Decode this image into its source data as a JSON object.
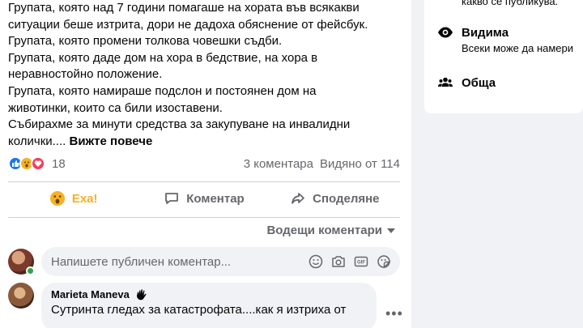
{
  "post": {
    "lines": [
      "Групата, която над 7 години помагаше на хората във всякакви",
      "ситуации беше изтрита, дори не дадоха обяснение от фейсбук.",
      "Групата, която промени толкова човешки съдби.",
      "Групата, която даде дом на хора в бедствие, на хора в",
      "неравностойно положение.",
      "Групата, която намираше подслон и постоянен дом на",
      "животинки, които са били изоставени.",
      "Събирахме за минути средства за закупуване на инвалидни",
      "колички...."
    ],
    "see_more": "Вижте повече"
  },
  "stats": {
    "reaction_count": "18",
    "comments": "3 коментара",
    "views": "Видяно от 114"
  },
  "actions": {
    "wow": "Еха!",
    "comment": "Коментар",
    "share": "Споделяне"
  },
  "sort": {
    "label": "Водещи коментари"
  },
  "composer": {
    "placeholder": "Напишете публичен коментар..."
  },
  "comment": {
    "author": "Marieta Maneva",
    "text": "Сутринта гледах за катастрофата....как я изтриха от"
  },
  "sidebar": {
    "top_text": "какво се публикува.",
    "visibility_title": "Видима",
    "visibility_sub": "Всеки може да намери",
    "type_title": "Обща"
  },
  "colors": {
    "accent": "#1877f2",
    "wow": "#f7b125",
    "muted": "#65676b",
    "online": "#31a24c"
  }
}
